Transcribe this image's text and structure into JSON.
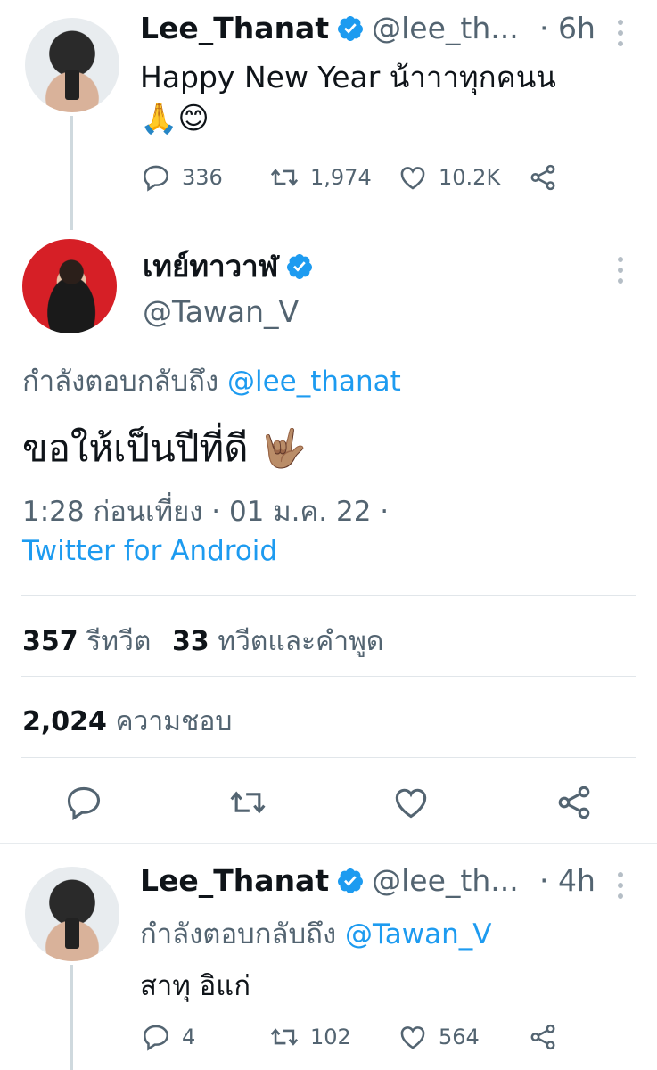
{
  "tweet1": {
    "display_name": "Lee_Thanat",
    "handle": "@lee_th...",
    "time": "· 6h",
    "text_line1": "Happy New Year น้าาาทุกคนน",
    "emoji": "🙏😊",
    "replies": "336",
    "retweets": "1,974",
    "likes": "10.2K"
  },
  "tweet2": {
    "display_name": "เทย์ทาวาฬ",
    "handle": "@Tawan_V",
    "replying_prefix": "กำลังตอบกลับถึง",
    "replying_to": "@lee_thanat",
    "text": "ขอให้เป็นปีที่ดี",
    "emoji": "🤟🏽",
    "timestamp": "1:28 ก่อนเที่ยง · 01 ม.ค. 22 ·",
    "source": "Twitter for Android",
    "retweets_count": "357",
    "retweets_label": "รีทวีต",
    "quotes_count": "33",
    "quotes_label": "ทวีตและคำพูด",
    "likes_count": "2,024",
    "likes_label": "ความชอบ"
  },
  "tweet3": {
    "display_name": "Lee_Thanat",
    "handle": "@lee_th...",
    "time": "· 4h",
    "replying_prefix": "กำลังตอบกลับถึง",
    "replying_to": "@Tawan_V",
    "text": "สาทุ อิแก่",
    "replies": "4",
    "retweets": "102",
    "likes": "564"
  },
  "colors": {
    "accent": "#1d9bf0",
    "text": "#0f1419",
    "secondary": "#536471",
    "divider": "#e1e6ea"
  },
  "icons": [
    "verified-badge-icon",
    "reply-icon",
    "retweet-icon",
    "like-icon",
    "share-icon",
    "more-icon"
  ]
}
